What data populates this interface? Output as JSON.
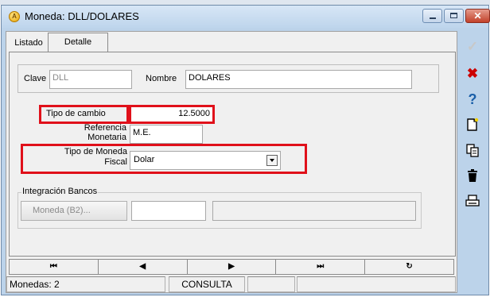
{
  "window": {
    "title": "Moneda: DLL/DOLARES"
  },
  "tabs": [
    {
      "label": "Listado"
    },
    {
      "label": "Detalle"
    }
  ],
  "form": {
    "clave_label": "Clave",
    "clave_value": "DLL",
    "nombre_label": "Nombre",
    "nombre_value": "DOLARES",
    "tipo_cambio_label": "Tipo de cambio",
    "tipo_cambio_value": "12.5000",
    "referencia_label_1": "Referencia",
    "referencia_label_2": "Monetaria",
    "referencia_value": "M.E.",
    "tipo_moneda_label_1": "Tipo de Moneda",
    "tipo_moneda_label_2": "Fiscal",
    "tipo_moneda_value": "Dolar"
  },
  "integracion": {
    "group_label": "Integración Bancos",
    "button_label": "Moneda (B2)...",
    "field1_value": "",
    "field2_value": ""
  },
  "nav": {
    "first": "⏮",
    "prev": "◀",
    "next": "▶",
    "last": "⏭",
    "refresh": "↻"
  },
  "status": {
    "count_text": "Monedas: 2",
    "mode_text": "CONSULTA",
    "cell3": "",
    "cell4": ""
  },
  "toolbar": {
    "accept_icon": "check-icon",
    "cancel_icon": "close-icon",
    "help_icon": "question-icon",
    "new_icon": "new-document-icon",
    "copy_icon": "copy-icon",
    "delete_icon": "trash-icon",
    "print_icon": "printer-icon"
  },
  "colors": {
    "highlight": "#e0101a",
    "titlebar": "#bed5ec",
    "close_button": "#c2412a"
  }
}
